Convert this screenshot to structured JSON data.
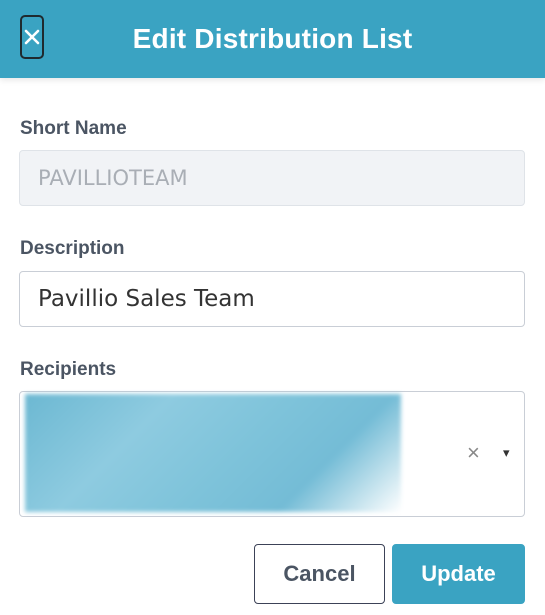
{
  "header": {
    "title": "Edit Distribution List",
    "close_icon": "close-icon",
    "background_color": "#3aa3c2"
  },
  "form": {
    "short_name": {
      "label": "Short Name",
      "value": "PAVILLIOTEAM",
      "disabled": true
    },
    "description": {
      "label": "Description",
      "value": "Pavillio Sales Team"
    },
    "recipients": {
      "label": "Recipients",
      "clear_icon": "×",
      "dropdown_icon": "▾"
    }
  },
  "actions": {
    "cancel_label": "Cancel",
    "update_label": "Update",
    "accent_color": "#3aa3c2"
  }
}
